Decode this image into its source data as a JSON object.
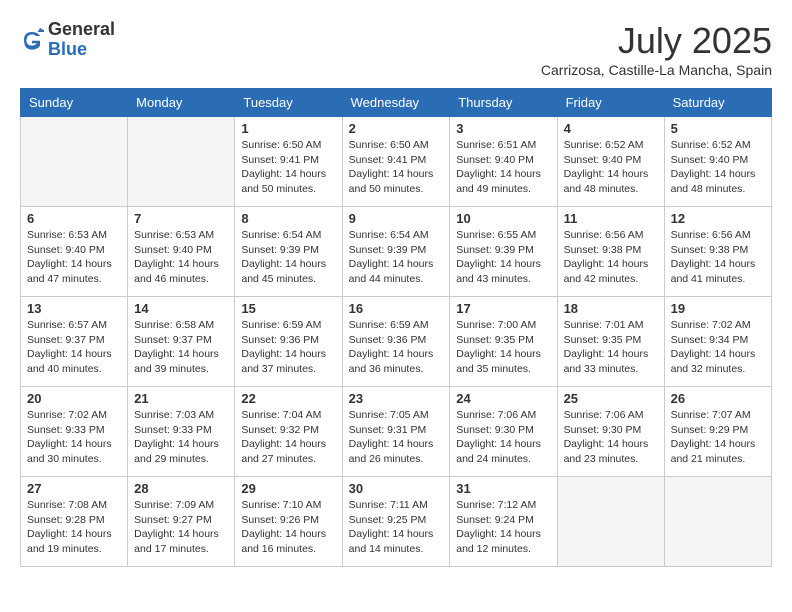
{
  "logo": {
    "general": "General",
    "blue": "Blue"
  },
  "title": "July 2025",
  "location": "Carrizosa, Castille-La Mancha, Spain",
  "days_of_week": [
    "Sunday",
    "Monday",
    "Tuesday",
    "Wednesday",
    "Thursday",
    "Friday",
    "Saturday"
  ],
  "weeks": [
    [
      {
        "day": "",
        "empty": true
      },
      {
        "day": "",
        "empty": true
      },
      {
        "day": "1",
        "sunrise": "Sunrise: 6:50 AM",
        "sunset": "Sunset: 9:41 PM",
        "daylight": "Daylight: 14 hours and 50 minutes."
      },
      {
        "day": "2",
        "sunrise": "Sunrise: 6:50 AM",
        "sunset": "Sunset: 9:41 PM",
        "daylight": "Daylight: 14 hours and 50 minutes."
      },
      {
        "day": "3",
        "sunrise": "Sunrise: 6:51 AM",
        "sunset": "Sunset: 9:40 PM",
        "daylight": "Daylight: 14 hours and 49 minutes."
      },
      {
        "day": "4",
        "sunrise": "Sunrise: 6:52 AM",
        "sunset": "Sunset: 9:40 PM",
        "daylight": "Daylight: 14 hours and 48 minutes."
      },
      {
        "day": "5",
        "sunrise": "Sunrise: 6:52 AM",
        "sunset": "Sunset: 9:40 PM",
        "daylight": "Daylight: 14 hours and 48 minutes."
      }
    ],
    [
      {
        "day": "6",
        "sunrise": "Sunrise: 6:53 AM",
        "sunset": "Sunset: 9:40 PM",
        "daylight": "Daylight: 14 hours and 47 minutes."
      },
      {
        "day": "7",
        "sunrise": "Sunrise: 6:53 AM",
        "sunset": "Sunset: 9:40 PM",
        "daylight": "Daylight: 14 hours and 46 minutes."
      },
      {
        "day": "8",
        "sunrise": "Sunrise: 6:54 AM",
        "sunset": "Sunset: 9:39 PM",
        "daylight": "Daylight: 14 hours and 45 minutes."
      },
      {
        "day": "9",
        "sunrise": "Sunrise: 6:54 AM",
        "sunset": "Sunset: 9:39 PM",
        "daylight": "Daylight: 14 hours and 44 minutes."
      },
      {
        "day": "10",
        "sunrise": "Sunrise: 6:55 AM",
        "sunset": "Sunset: 9:39 PM",
        "daylight": "Daylight: 14 hours and 43 minutes."
      },
      {
        "day": "11",
        "sunrise": "Sunrise: 6:56 AM",
        "sunset": "Sunset: 9:38 PM",
        "daylight": "Daylight: 14 hours and 42 minutes."
      },
      {
        "day": "12",
        "sunrise": "Sunrise: 6:56 AM",
        "sunset": "Sunset: 9:38 PM",
        "daylight": "Daylight: 14 hours and 41 minutes."
      }
    ],
    [
      {
        "day": "13",
        "sunrise": "Sunrise: 6:57 AM",
        "sunset": "Sunset: 9:37 PM",
        "daylight": "Daylight: 14 hours and 40 minutes."
      },
      {
        "day": "14",
        "sunrise": "Sunrise: 6:58 AM",
        "sunset": "Sunset: 9:37 PM",
        "daylight": "Daylight: 14 hours and 39 minutes."
      },
      {
        "day": "15",
        "sunrise": "Sunrise: 6:59 AM",
        "sunset": "Sunset: 9:36 PM",
        "daylight": "Daylight: 14 hours and 37 minutes."
      },
      {
        "day": "16",
        "sunrise": "Sunrise: 6:59 AM",
        "sunset": "Sunset: 9:36 PM",
        "daylight": "Daylight: 14 hours and 36 minutes."
      },
      {
        "day": "17",
        "sunrise": "Sunrise: 7:00 AM",
        "sunset": "Sunset: 9:35 PM",
        "daylight": "Daylight: 14 hours and 35 minutes."
      },
      {
        "day": "18",
        "sunrise": "Sunrise: 7:01 AM",
        "sunset": "Sunset: 9:35 PM",
        "daylight": "Daylight: 14 hours and 33 minutes."
      },
      {
        "day": "19",
        "sunrise": "Sunrise: 7:02 AM",
        "sunset": "Sunset: 9:34 PM",
        "daylight": "Daylight: 14 hours and 32 minutes."
      }
    ],
    [
      {
        "day": "20",
        "sunrise": "Sunrise: 7:02 AM",
        "sunset": "Sunset: 9:33 PM",
        "daylight": "Daylight: 14 hours and 30 minutes."
      },
      {
        "day": "21",
        "sunrise": "Sunrise: 7:03 AM",
        "sunset": "Sunset: 9:33 PM",
        "daylight": "Daylight: 14 hours and 29 minutes."
      },
      {
        "day": "22",
        "sunrise": "Sunrise: 7:04 AM",
        "sunset": "Sunset: 9:32 PM",
        "daylight": "Daylight: 14 hours and 27 minutes."
      },
      {
        "day": "23",
        "sunrise": "Sunrise: 7:05 AM",
        "sunset": "Sunset: 9:31 PM",
        "daylight": "Daylight: 14 hours and 26 minutes."
      },
      {
        "day": "24",
        "sunrise": "Sunrise: 7:06 AM",
        "sunset": "Sunset: 9:30 PM",
        "daylight": "Daylight: 14 hours and 24 minutes."
      },
      {
        "day": "25",
        "sunrise": "Sunrise: 7:06 AM",
        "sunset": "Sunset: 9:30 PM",
        "daylight": "Daylight: 14 hours and 23 minutes."
      },
      {
        "day": "26",
        "sunrise": "Sunrise: 7:07 AM",
        "sunset": "Sunset: 9:29 PM",
        "daylight": "Daylight: 14 hours and 21 minutes."
      }
    ],
    [
      {
        "day": "27",
        "sunrise": "Sunrise: 7:08 AM",
        "sunset": "Sunset: 9:28 PM",
        "daylight": "Daylight: 14 hours and 19 minutes."
      },
      {
        "day": "28",
        "sunrise": "Sunrise: 7:09 AM",
        "sunset": "Sunset: 9:27 PM",
        "daylight": "Daylight: 14 hours and 17 minutes."
      },
      {
        "day": "29",
        "sunrise": "Sunrise: 7:10 AM",
        "sunset": "Sunset: 9:26 PM",
        "daylight": "Daylight: 14 hours and 16 minutes."
      },
      {
        "day": "30",
        "sunrise": "Sunrise: 7:11 AM",
        "sunset": "Sunset: 9:25 PM",
        "daylight": "Daylight: 14 hours and 14 minutes."
      },
      {
        "day": "31",
        "sunrise": "Sunrise: 7:12 AM",
        "sunset": "Sunset: 9:24 PM",
        "daylight": "Daylight: 14 hours and 12 minutes."
      },
      {
        "day": "",
        "empty": true
      },
      {
        "day": "",
        "empty": true
      }
    ]
  ]
}
